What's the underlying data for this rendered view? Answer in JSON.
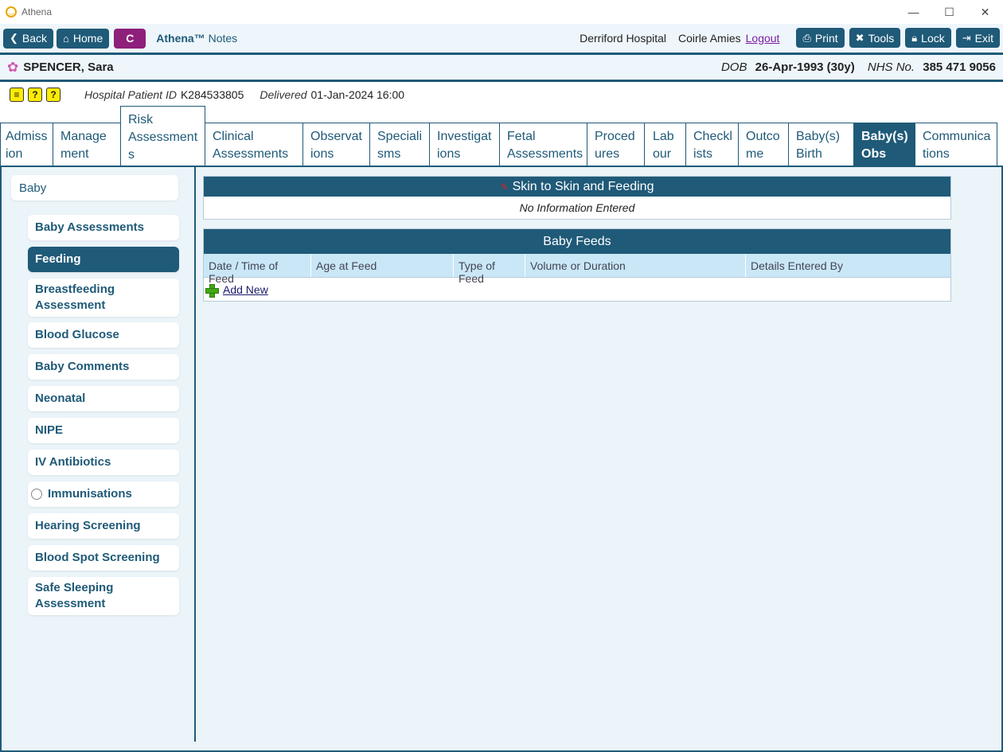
{
  "window": {
    "title": "Athena",
    "controls": [
      "—",
      "☐",
      "✕"
    ]
  },
  "toolbar": {
    "back_label": "Back",
    "home_label": "Home",
    "c_label": "C",
    "brand_name": "Athena™",
    "brand_suffix": "Notes",
    "hospital": "Derriford Hospital",
    "user": "Coirle Amies",
    "logout_label": "Logout",
    "print_label": "Print",
    "tools_label": "Tools",
    "lock_label": "Lock",
    "exit_label": "Exit"
  },
  "patient": {
    "name": "SPENCER, Sara",
    "dob_label": "DOB",
    "dob": "26-Apr-1993 (30y)",
    "nhs_label": "NHS No.",
    "nhs": "385 471 9056"
  },
  "info": {
    "hospital_id_label": "Hospital Patient ID",
    "hospital_id": "K284533805",
    "delivered_label": "Delivered",
    "delivered": "01-Jan-2024 16:00"
  },
  "tabs": [
    {
      "l1": "Admiss",
      "l2": "ion"
    },
    {
      "l1": "Manage",
      "l2": "ment"
    },
    {
      "l1": "Risk",
      "l2": "Assessment",
      "l3": "s"
    },
    {
      "l1": "Clinical",
      "l2": "Assessments"
    },
    {
      "l1": "Observat",
      "l2": "ions"
    },
    {
      "l1": "Speciali",
      "l2": "sms"
    },
    {
      "l1": "Investigat",
      "l2": "ions"
    },
    {
      "l1": "Fetal",
      "l2": "Assessments"
    },
    {
      "l1": "Proced",
      "l2": "ures"
    },
    {
      "l1": "Lab",
      "l2": "our"
    },
    {
      "l1": "Checkl",
      "l2": "ists"
    },
    {
      "l1": "Outco",
      "l2": "me"
    },
    {
      "l1": "Baby(s)",
      "l2": "Birth"
    },
    {
      "l1": "Baby(s)",
      "l2": "Obs"
    },
    {
      "l1": "Communica",
      "l2": "tions"
    }
  ],
  "sidebar": {
    "parent": "Baby",
    "items": [
      {
        "label": "Baby Assessments"
      },
      {
        "label": "Feeding"
      },
      {
        "label": "Breastfeeding Assessment"
      },
      {
        "label": "Blood Glucose"
      },
      {
        "label": "Baby Comments"
      },
      {
        "label": "Neonatal"
      },
      {
        "label": "NIPE"
      },
      {
        "label": "IV Antibiotics"
      },
      {
        "label": "Immunisations"
      },
      {
        "label": "Hearing Screening"
      },
      {
        "label": "Blood Spot Screening"
      },
      {
        "label": "Safe Sleeping Assessment"
      }
    ]
  },
  "skin_panel": {
    "title": "Skin to Skin and Feeding",
    "empty_text": "No Information Entered"
  },
  "feeds_panel": {
    "title": "Baby Feeds",
    "columns": [
      "Date / Time of Feed",
      "Age at Feed",
      "Type of Feed",
      "Volume or Duration",
      "Details Entered By"
    ],
    "add_label": "Add New"
  },
  "colors": {
    "primary": "#1f5a78",
    "c_button": "#8e1f7a",
    "background": "#eaf4f9",
    "column_header": "#c9e7f7"
  }
}
